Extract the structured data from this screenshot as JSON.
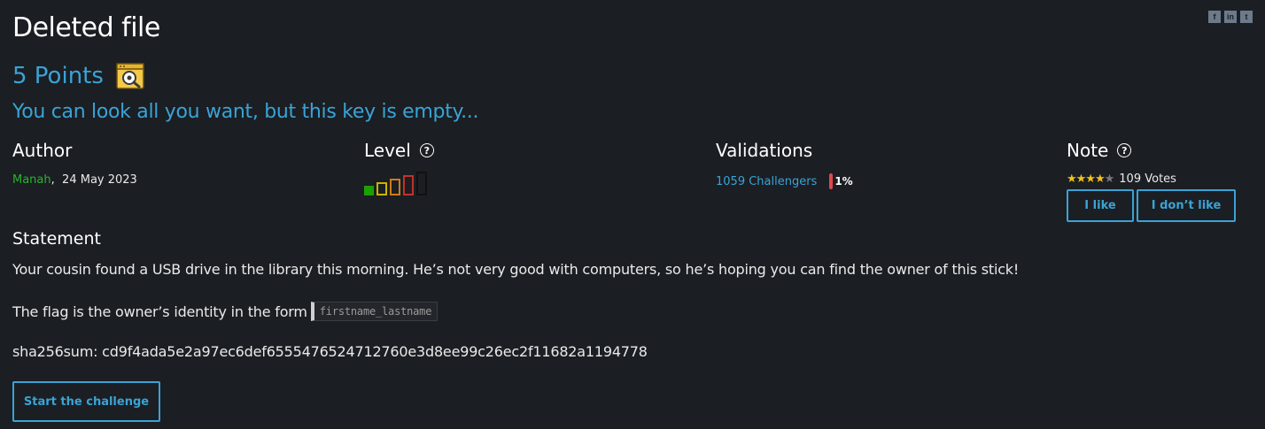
{
  "challenge": {
    "title": "Deleted file",
    "points": "5 Points",
    "category_icon": "forensic-magnifier-icon",
    "subtitle": "You can look all you want, but this key is empty..."
  },
  "author": {
    "heading": "Author",
    "name": "Manah",
    "separator": ",",
    "date": "24 May 2023"
  },
  "level": {
    "heading": "Level",
    "help_icon": "help-circle-icon",
    "value": 1,
    "max": 5,
    "colors": [
      "#1ca000",
      "#c8b400",
      "#d27a1a",
      "#c0322a",
      "#111111"
    ]
  },
  "validations": {
    "heading": "Validations",
    "challengers": "1059 Challengers",
    "percent": "1%",
    "accent": "#e0474c"
  },
  "note": {
    "heading": "Note",
    "help_icon": "help-circle-icon",
    "stars_filled": "★★★★",
    "stars_empty": "★",
    "rating": 4,
    "votes": "109 Votes",
    "like_label": "I like",
    "dislike_label": "I don’t like"
  },
  "statement": {
    "heading": "Statement",
    "p1": "Your cousin found a USB drive in the library this morning. He’s not very good with computers, so he’s hoping you can find the owner of this stick!",
    "p2_prefix": "The flag is the owner’s identity in the form",
    "p2_format": "firstname_lastname",
    "p3": "sha256sum: cd9f4ada5e2a97ec6def6555476524712760e3d8ee99c26ec2f11682a1194778"
  },
  "actions": {
    "start_label": "Start the challenge"
  },
  "share": {
    "facebook": "f",
    "linkedin": "in",
    "other": "t"
  },
  "colors": {
    "background": "#1b1e23",
    "accent": "#3aa3d6",
    "author": "#29b32e",
    "star": "#f3c317"
  }
}
